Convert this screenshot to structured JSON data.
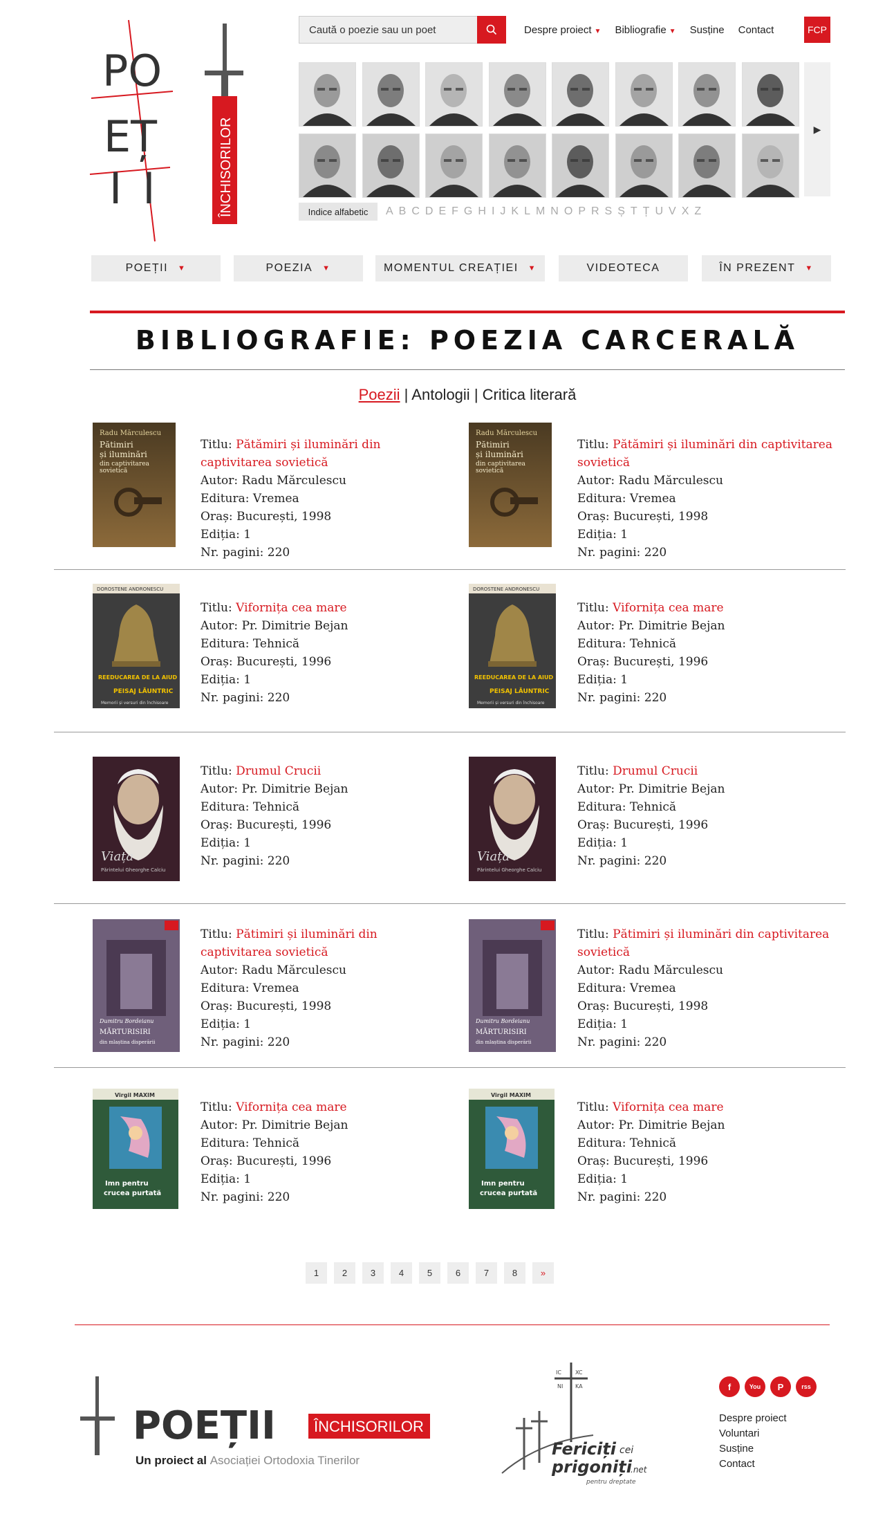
{
  "search": {
    "placeholder": "Caută o poezie sau un poet"
  },
  "topnav": [
    {
      "label": "Despre proiect",
      "has_dropdown": true
    },
    {
      "label": "Bibliografie",
      "has_dropdown": true
    },
    {
      "label": "Susține",
      "has_dropdown": false
    },
    {
      "label": "Contact",
      "has_dropdown": false
    }
  ],
  "fcp_label": "FCP",
  "logo": {
    "word1": "PO",
    "word2": "EȚ",
    "word3": "II",
    "banner": "ÎNCHISORILOR"
  },
  "alphabet": {
    "label": "Indice alfabetic",
    "letters": [
      "A",
      "B",
      "C",
      "D",
      "E",
      "F",
      "G",
      "H",
      "I",
      "J",
      "K",
      "L",
      "M",
      "N",
      "O",
      "P",
      "R",
      "S",
      "Ș",
      "T",
      "Ț",
      "U",
      "V",
      "X",
      "Z"
    ]
  },
  "mainnav": [
    {
      "label": "POEȚII",
      "has_dropdown": true
    },
    {
      "label": "POEZIA",
      "has_dropdown": true
    },
    {
      "label": "MOMENTUL CREAȚIEI",
      "has_dropdown": true
    },
    {
      "label": "VIDEOTECA",
      "has_dropdown": false
    },
    {
      "label": "ÎN PREZENT",
      "has_dropdown": true
    }
  ],
  "page_title": "BIBLIOGRAFIE: POEZIA CARCERALĂ",
  "subnav": {
    "active": "Poezii",
    "sep": "|",
    "link2": "Antologii",
    "link3": "Critica literară"
  },
  "field_labels": {
    "title": "Titlu: ",
    "author": "Autor: ",
    "publisher": "Editura: ",
    "city": "Oraș: ",
    "edition": "Ediția: ",
    "pages": "Nr. pagini: "
  },
  "books": [
    {
      "title": "Pătămiri și iluminări din captivitarea sovietică",
      "author": "Radu Mărculescu",
      "publisher": "Vremea",
      "city": "București, 1998",
      "edition": "1",
      "pages": "220"
    },
    {
      "title": "Pătămiri și iluminări din captivitarea sovietică",
      "author": "Radu Mărculescu",
      "publisher": "Vremea",
      "city": "București, 1998",
      "edition": "1",
      "pages": "220"
    },
    {
      "title": "Vifornița cea mare",
      "author": "Pr. Dimitrie Bejan",
      "publisher": "Tehnică",
      "city": "București, 1996",
      "edition": "1",
      "pages": "220"
    },
    {
      "title": "Vifornița cea mare",
      "author": "Pr. Dimitrie Bejan",
      "publisher": "Tehnică",
      "city": "București, 1996",
      "edition": "1",
      "pages": "220"
    },
    {
      "title": "Drumul Crucii",
      "author": "Pr. Dimitrie Bejan",
      "publisher": "Tehnică",
      "city": "București, 1996",
      "edition": "1",
      "pages": "220"
    },
    {
      "title": "Drumul Crucii",
      "author": "Pr. Dimitrie Bejan",
      "publisher": "Tehnică",
      "city": "București, 1996",
      "edition": "1",
      "pages": "220"
    },
    {
      "title": "Pătimiri și iluminări din captivitarea sovietică",
      "author": "Radu Mărculescu",
      "publisher": "Vremea",
      "city": "București, 1998",
      "edition": "1",
      "pages": "220"
    },
    {
      "title": "Pătimiri și iluminări din captivitarea sovietică",
      "author": "Radu Mărculescu",
      "publisher": "Vremea",
      "city": "București, 1998",
      "edition": "1",
      "pages": "220"
    },
    {
      "title": "Vifornița cea mare",
      "author": "Pr. Dimitrie Bejan",
      "publisher": "Tehnică",
      "city": "București, 1996",
      "edition": "1",
      "pages": "220"
    },
    {
      "title": "Vifornița cea mare",
      "author": "Pr. Dimitrie Bejan",
      "publisher": "Tehnică",
      "city": "București, 1996",
      "edition": "1",
      "pages": "220"
    }
  ],
  "covers": [
    {
      "top": "Radu Mărculescu",
      "main": "Pătimiri și iluminări din captivitarea sovietică"
    },
    {
      "top": "DOROSTENE ANDRONESCU",
      "main": "REEDUCAREA DE LA AIUD",
      "sub": "PEISAJ LĂUNTRIC",
      "foot": "Memorii și versuri din închisoare"
    },
    {
      "main": "Viața",
      "sub": "Părintelui Gheorghe Calciu"
    },
    {
      "top": "Dumitru Bordeianu",
      "main": "MĂRTURISIRI",
      "sub": "din mlaștina disperării"
    },
    {
      "top": "Virgil MAXIM",
      "main": "Imn pentru crucea purtată"
    }
  ],
  "pager": [
    "1",
    "2",
    "3",
    "4",
    "5",
    "6",
    "7",
    "8",
    "»"
  ],
  "footer": {
    "logo_main": "POEȚII",
    "logo_banner": "ÎNCHISORILOR",
    "sub_prefix": "Un proiect al ",
    "sub_org": "Asociației Ortodoxia Tinerilor",
    "fericiti_line1": "Fericiți",
    "fericiti_cei": "cei",
    "fericiti_line2": "prigoniți",
    "fericiti_net": ".net",
    "fericiti_tag": "pentru dreptate",
    "fericiti_ic": "IC",
    "fericiti_xc": "XC",
    "fericiti_ni": "NI",
    "fericiti_ka": "KA",
    "social": [
      "f",
      "You",
      "P",
      "rss"
    ],
    "links": [
      "Despre proiect",
      "Voluntari",
      "Susține",
      "Contact"
    ]
  },
  "colors": {
    "accent": "#d71920"
  }
}
